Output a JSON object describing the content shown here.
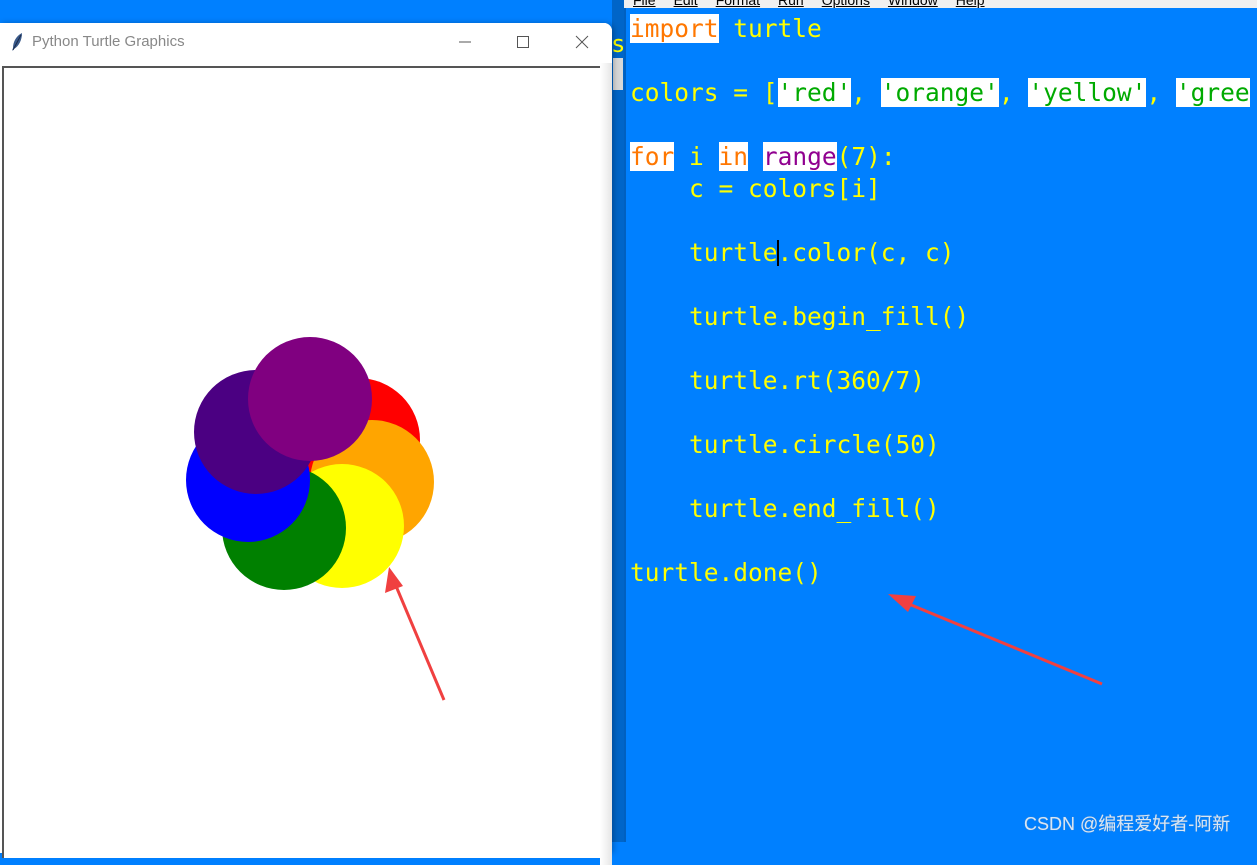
{
  "turtle_window": {
    "title": "Python Turtle Graphics",
    "icon": "feather-icon",
    "controls": [
      "minimize-icon",
      "maximize-icon",
      "close-icon"
    ],
    "drawing": {
      "description": "7 overlapping filled circles arranged in a rosette",
      "circles": [
        {
          "name": "red",
          "color": "#ff0000"
        },
        {
          "name": "orange",
          "color": "#ffa500"
        },
        {
          "name": "yellow",
          "color": "#ffff00"
        },
        {
          "name": "green",
          "color": "#008000"
        },
        {
          "name": "blue",
          "color": "#0000ff"
        },
        {
          "name": "indigo",
          "color": "#4b0082"
        },
        {
          "name": "purple",
          "color": "#800080"
        }
      ],
      "annotation_arrow_color": "#f04040"
    }
  },
  "strip_char": "s",
  "editor": {
    "menu": [
      "File",
      "Edit",
      "Format",
      "Run",
      "Options",
      "Window",
      "Help"
    ],
    "background": "#0080ff",
    "code": {
      "l1_kw": "import",
      "l1_rest": " turtle",
      "l2_a": "colors = [",
      "l2_s1": "'red'",
      "l2_c1": ", ",
      "l2_s2": "'orange'",
      "l2_c2": ", ",
      "l2_s3": "'yellow'",
      "l2_c3": ", ",
      "l2_s4": "'gree",
      "l3_kw1": "for",
      "l3_a": " i ",
      "l3_kw2": "in",
      "l3_b": " ",
      "l3_bi": "range",
      "l3_c": "(7):",
      "l4": "    c = colors[i]",
      "l5_a": "    turtle",
      "l5_b": ".color(c, c)",
      "l6": "    turtle.begin_fill()",
      "l7": "    turtle.rt(360/7)",
      "l8": "    turtle.circle(50)",
      "l9": "    turtle.end_fill()",
      "l10": "turtle.done()"
    }
  },
  "watermark": "CSDN @编程爱好者-阿新"
}
